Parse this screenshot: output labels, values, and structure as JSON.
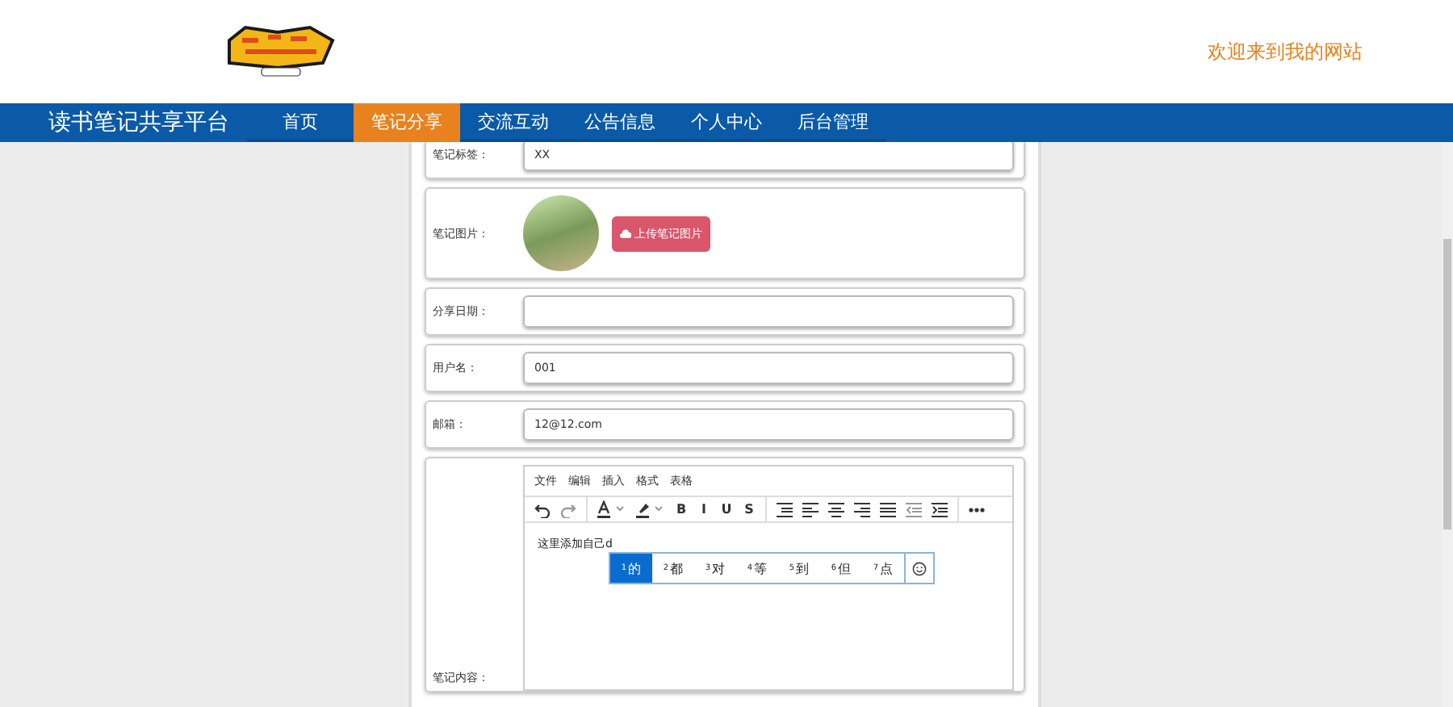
{
  "header": {
    "welcome": "欢迎来到我的网站"
  },
  "nav": {
    "title": "读书笔记共享平台",
    "items": [
      {
        "label": "首页",
        "selected": false
      },
      {
        "label": "笔记分享",
        "selected": true
      },
      {
        "label": "交流互动",
        "selected": false
      },
      {
        "label": "公告信息",
        "selected": false
      },
      {
        "label": "个人中心",
        "selected": false
      },
      {
        "label": "后台管理",
        "selected": false
      }
    ]
  },
  "form": {
    "rows": [
      {
        "kind": "text",
        "label": "笔记标签：",
        "value": "XX"
      },
      {
        "kind": "image",
        "label": "笔记图片：",
        "button": "上传笔记图片"
      },
      {
        "kind": "text",
        "label": "分享日期：",
        "value": ""
      },
      {
        "kind": "text",
        "label": "用户名：",
        "value": "001"
      },
      {
        "kind": "text",
        "label": "邮箱：",
        "value": "12@12.com"
      },
      {
        "kind": "editor",
        "label": "笔记内容："
      }
    ]
  },
  "editor": {
    "menu": [
      "文件",
      "编辑",
      "插入",
      "格式",
      "表格"
    ],
    "toolbar": [
      [
        {
          "kind": "undo"
        },
        {
          "kind": "redo"
        }
      ],
      [
        {
          "kind": "font-color"
        },
        {
          "kind": "highlight"
        },
        {
          "kind": "letter",
          "text": "B"
        },
        {
          "kind": "letter",
          "text": "I"
        },
        {
          "kind": "letter",
          "text": "U"
        },
        {
          "kind": "letter",
          "text": "S"
        }
      ],
      [
        {
          "kind": "line-height"
        },
        {
          "kind": "align-left"
        },
        {
          "kind": "align-center"
        },
        {
          "kind": "align-right"
        },
        {
          "kind": "justify"
        },
        {
          "kind": "outdent"
        },
        {
          "kind": "indent"
        }
      ],
      [
        {
          "kind": "more"
        }
      ]
    ],
    "content": "这里添加自己d",
    "candidates": [
      {
        "index": "1",
        "text": "的",
        "selected": true
      },
      {
        "index": "2",
        "text": "都",
        "selected": false
      },
      {
        "index": "3",
        "text": "对",
        "selected": false
      },
      {
        "index": "4",
        "text": "等",
        "selected": false
      },
      {
        "index": "5",
        "text": "到",
        "selected": false
      },
      {
        "index": "6",
        "text": "但",
        "selected": false
      },
      {
        "index": "7",
        "text": "点",
        "selected": false
      }
    ]
  }
}
